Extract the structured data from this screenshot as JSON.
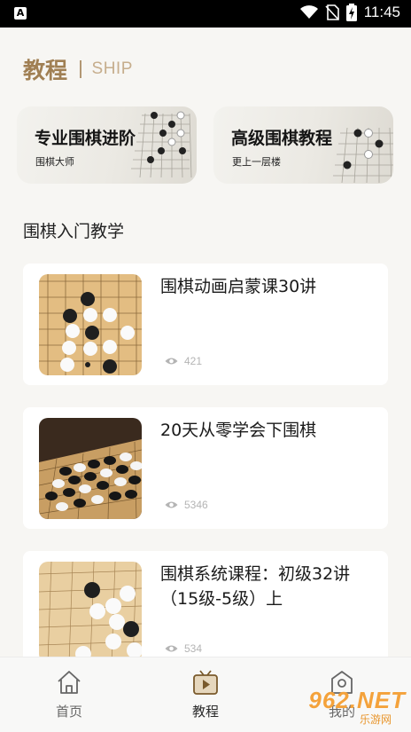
{
  "status_bar": {
    "time": "11:45",
    "app_icon_letter": "A"
  },
  "header": {
    "title": "教程",
    "subtitle": "SHIP"
  },
  "promos": [
    {
      "title": "专业围棋进阶",
      "subtitle": "围棋大师"
    },
    {
      "title": "高级围棋教程",
      "subtitle": "更上一层楼"
    }
  ],
  "section": {
    "title": "围棋入门教学"
  },
  "courses": [
    {
      "title": "围棋动画启蒙课30讲",
      "views": "421"
    },
    {
      "title": "20天从零学会下围棋",
      "views": "5346"
    },
    {
      "title": "围棋系统课程：初级32讲（15级-5级）上",
      "views": "534"
    }
  ],
  "tabs": [
    {
      "label": "首页",
      "icon": "home-icon",
      "active": false
    },
    {
      "label": "教程",
      "icon": "video-icon",
      "active": true
    },
    {
      "label": "我的",
      "icon": "profile-icon",
      "active": false
    }
  ],
  "watermark": {
    "brand": "962.NET",
    "sub": "乐游网"
  },
  "colors": {
    "accent": "#a07f53",
    "active_tab": "#7a5a2c",
    "inactive_tab": "#666666"
  }
}
